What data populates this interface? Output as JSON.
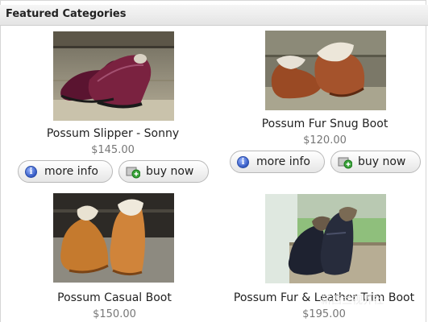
{
  "header": {
    "title": "Featured Categories"
  },
  "products": [
    {
      "name": "Possum Slipper - Sonny",
      "price": "$145.00",
      "more_info": "more info",
      "buy_now": "buy now"
    },
    {
      "name": "Possum Fur Snug Boot",
      "price": "$120.00",
      "more_info": "more info",
      "buy_now": "buy now"
    },
    {
      "name": "Possum Casual Boot",
      "price": "$150.00"
    },
    {
      "name": "Possum Fur & Leather Trim Boot",
      "price": "$195.00"
    }
  ],
  "icons": {
    "info": "info-icon",
    "cart": "add-to-cart-icon"
  },
  "colors": {
    "price": "#777777",
    "header_bg": "#e8e8e8",
    "button_border": "#b9b9b9"
  },
  "watermark": "新西兰视界社"
}
